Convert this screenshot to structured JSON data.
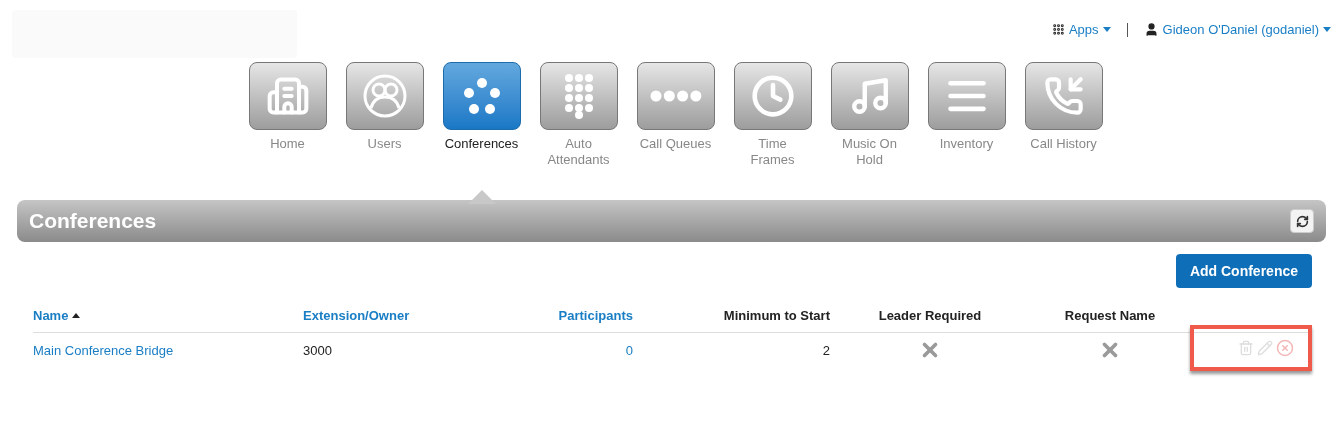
{
  "header": {
    "apps_menu": {
      "label": "Apps"
    },
    "user_menu": {
      "label": "Gideon O'Daniel (godaniel)"
    }
  },
  "nav": [
    {
      "kind": "building",
      "label": [
        "Home"
      ],
      "selected": false
    },
    {
      "kind": "users",
      "label": [
        "Users"
      ],
      "selected": false
    },
    {
      "kind": "conference",
      "label": [
        "Conferences"
      ],
      "selected": true
    },
    {
      "kind": "keypad",
      "label": [
        "Auto",
        "Attendants"
      ],
      "selected": false
    },
    {
      "kind": "queue",
      "label": [
        "Call Queues"
      ],
      "selected": false
    },
    {
      "kind": "clock",
      "label": [
        "Time",
        "Frames"
      ],
      "selected": false
    },
    {
      "kind": "music",
      "label": [
        "Music On",
        "Hold"
      ],
      "selected": false
    },
    {
      "kind": "list",
      "label": [
        "Inventory"
      ],
      "selected": false
    },
    {
      "kind": "history",
      "label": [
        "Call History"
      ],
      "selected": false
    }
  ],
  "panel": {
    "title": "Conferences",
    "add_button": "Add Conference"
  },
  "table": {
    "columns": [
      {
        "label": "Name",
        "sortable": true,
        "sorted": true
      },
      {
        "label": "Extension/Owner",
        "sortable": true,
        "sorted": false
      },
      {
        "label": "Participants",
        "sortable": true,
        "sorted": false
      },
      {
        "label": "Minimum to Start",
        "sortable": false,
        "sorted": false
      },
      {
        "label": "Leader Required",
        "sortable": false,
        "sorted": false
      },
      {
        "label": "Request Name",
        "sortable": false,
        "sorted": false
      }
    ],
    "rows": [
      {
        "name": "Main Conference Bridge",
        "extension": "3000",
        "participants": "0",
        "minimum": "2",
        "leader_required": false,
        "request_name": false
      }
    ]
  }
}
